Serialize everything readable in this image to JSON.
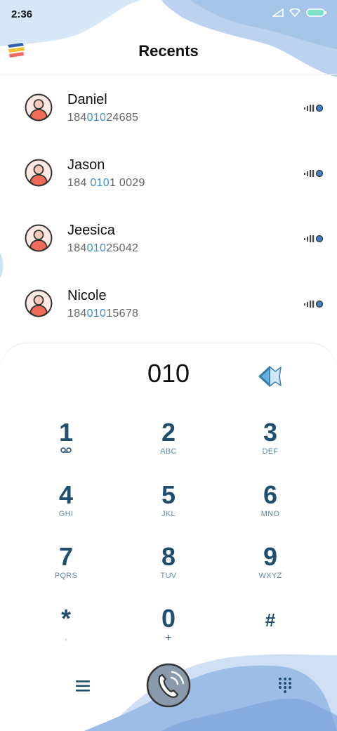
{
  "status_bar": {
    "time": "2:36"
  },
  "header": {
    "title": "Recents"
  },
  "contacts": [
    {
      "name": "Daniel",
      "num_pre": "184",
      "num_hl": "010",
      "num_post": "24685"
    },
    {
      "name": "Jason",
      "num_pre": "184 ",
      "num_hl": "010",
      "num_post": "1 0029"
    },
    {
      "name": "Jeesica",
      "num_pre": "184",
      "num_hl": "010",
      "num_post": "25042"
    },
    {
      "name": "Nicole",
      "num_pre": "184",
      "num_hl": "010",
      "num_post": "15678"
    }
  ],
  "dialer": {
    "input": "010",
    "keys": [
      {
        "digit": "1",
        "letters": ""
      },
      {
        "digit": "2",
        "letters": "ABC"
      },
      {
        "digit": "3",
        "letters": "DEF"
      },
      {
        "digit": "4",
        "letters": "GHI"
      },
      {
        "digit": "5",
        "letters": "JKL"
      },
      {
        "digit": "6",
        "letters": "MNO"
      },
      {
        "digit": "7",
        "letters": "PQRS"
      },
      {
        "digit": "8",
        "letters": "TUV"
      },
      {
        "digit": "9",
        "letters": "WXYZ"
      },
      {
        "digit": "*",
        "letters": ","
      },
      {
        "digit": "0",
        "letters": "+"
      },
      {
        "digit": "#",
        "letters": ""
      }
    ]
  },
  "colors": {
    "accent": "#3d8fd0",
    "key_digit": "#1f4e6e",
    "blob": "#9cbde6",
    "avatar_body": "#ef6b57"
  },
  "icons": {
    "menu": "colored-menu-icon",
    "voicemail": "voicemail-icon",
    "backspace": "backspace-icon",
    "call": "phone-call-icon",
    "list": "hamburger-icon",
    "keypad": "keypad-grid-icon",
    "signal": "signal-dot-icon"
  }
}
